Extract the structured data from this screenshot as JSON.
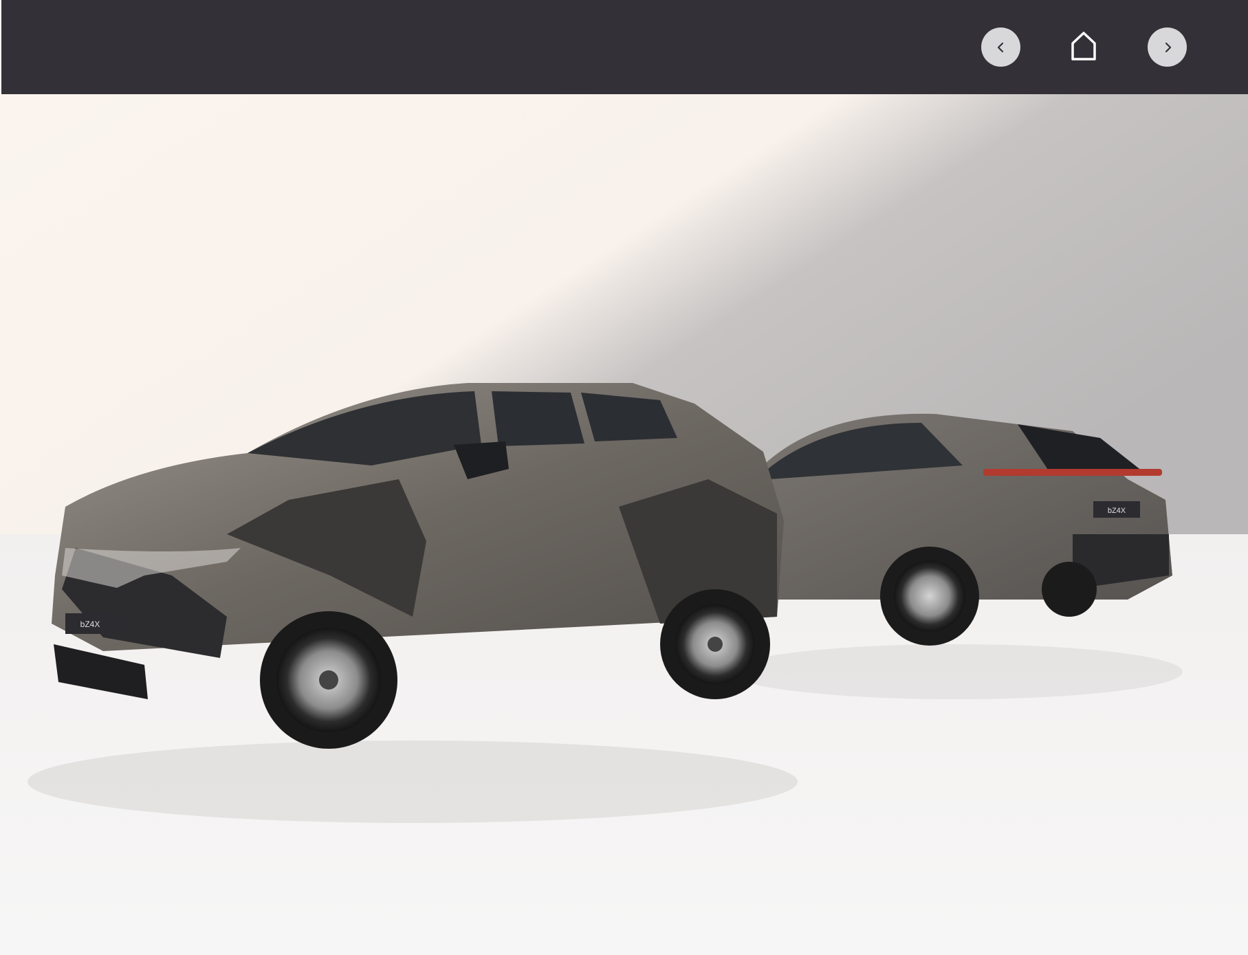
{
  "nav": {
    "prev_icon": "chevron-left-icon",
    "home_icon": "home-icon",
    "next_icon": "chevron-right-icon"
  },
  "hero": {
    "front_plate": "bZ4X",
    "rear_plate": "bZ4X"
  },
  "colors": {
    "topbar": "#333038",
    "nav_button": "#d8d8da",
    "icon": "#ffffff"
  }
}
